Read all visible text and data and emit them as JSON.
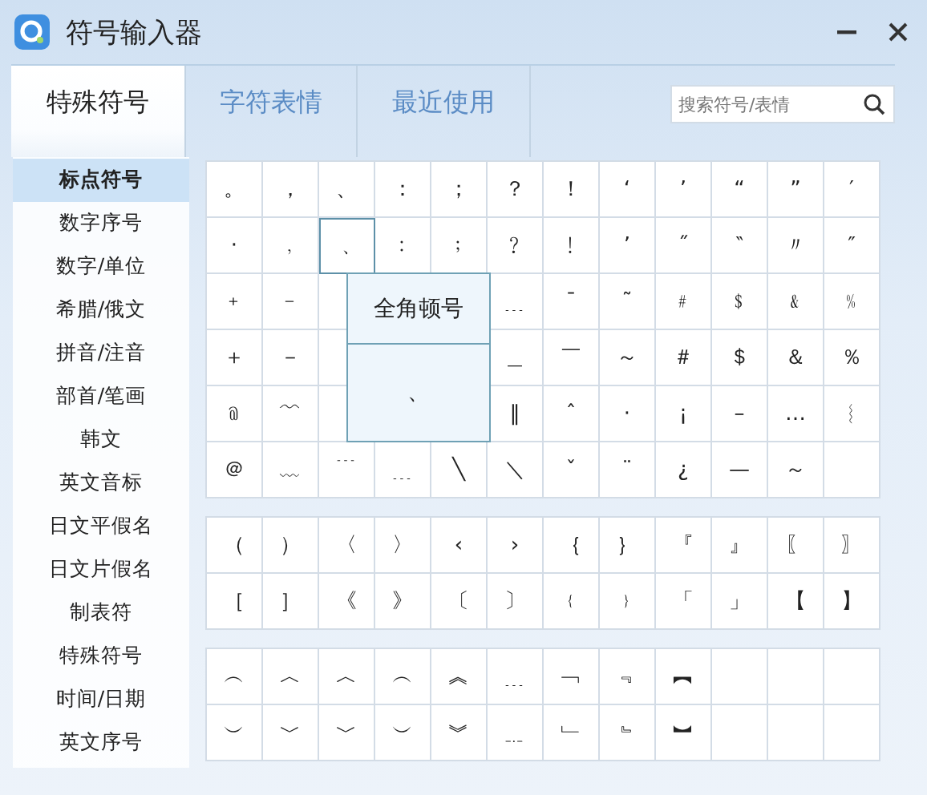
{
  "window": {
    "title": "符号输入器"
  },
  "tabs": [
    {
      "label": "特殊符号",
      "selected": true
    },
    {
      "label": "字符表情",
      "selected": false
    },
    {
      "label": "最近使用",
      "selected": false
    }
  ],
  "search": {
    "placeholder": "搜索符号/表情"
  },
  "sidebar": {
    "items": [
      {
        "label": "标点符号",
        "selected": true
      },
      {
        "label": "数字序号",
        "selected": false
      },
      {
        "label": "数字/单位",
        "selected": false
      },
      {
        "label": "希腊/俄文",
        "selected": false
      },
      {
        "label": "拼音/注音",
        "selected": false
      },
      {
        "label": "部首/笔画",
        "selected": false
      },
      {
        "label": "韩文",
        "selected": false
      },
      {
        "label": "英文音标",
        "selected": false
      },
      {
        "label": "日文平假名",
        "selected": false
      },
      {
        "label": "日文片假名",
        "selected": false
      },
      {
        "label": "制表符",
        "selected": false
      },
      {
        "label": "特殊符号",
        "selected": false
      },
      {
        "label": "时间/日期",
        "selected": false
      },
      {
        "label": "英文序号",
        "selected": false
      }
    ]
  },
  "blocks": [
    {
      "rows": [
        [
          {
            "symbol": "。",
            "hovered": false
          },
          {
            "symbol": "，",
            "hovered": false
          },
          {
            "symbol": "、",
            "hovered": false
          },
          {
            "symbol": "：",
            "hovered": false
          },
          {
            "symbol": "；",
            "hovered": false
          },
          {
            "symbol": "？",
            "hovered": false
          },
          {
            "symbol": "！",
            "hovered": false
          },
          {
            "symbol": "‘",
            "hovered": false
          },
          {
            "symbol": "’",
            "hovered": false
          },
          {
            "symbol": "“",
            "hovered": false
          },
          {
            "symbol": "”",
            "hovered": false
          },
          {
            "symbol": "′",
            "hovered": false
          }
        ],
        [
          {
            "symbol": "·",
            "hovered": false
          },
          {
            "symbol": "﹐",
            "hovered": false
          },
          {
            "symbol": "﹑",
            "hovered": true
          },
          {
            "symbol": "﹕",
            "hovered": false
          },
          {
            "symbol": "﹔",
            "hovered": false
          },
          {
            "symbol": "﹖",
            "hovered": false
          },
          {
            "symbol": "﹗",
            "hovered": false
          },
          {
            "symbol": "ʼ",
            "hovered": false
          },
          {
            "symbol": "˝",
            "hovered": false
          },
          {
            "symbol": "‶",
            "hovered": false
          },
          {
            "symbol": "〃",
            "hovered": false
          },
          {
            "symbol": "″",
            "hovered": false
          }
        ],
        [
          {
            "symbol": "﹢",
            "hovered": false
          },
          {
            "symbol": "﹣",
            "hovered": false
          },
          null,
          null,
          null,
          {
            "symbol": "﹍",
            "hovered": false
          },
          {
            "symbol": "¯",
            "hovered": false
          },
          {
            "symbol": "˜",
            "hovered": false
          },
          {
            "symbol": "﹟",
            "hovered": false
          },
          {
            "symbol": "﹩",
            "hovered": false
          },
          {
            "symbol": "﹠",
            "hovered": false
          },
          {
            "symbol": "﹪",
            "hovered": false
          }
        ],
        [
          {
            "symbol": "＋",
            "hovered": false
          },
          {
            "symbol": "－",
            "hovered": false
          },
          null,
          null,
          null,
          {
            "symbol": "＿",
            "hovered": false
          },
          {
            "symbol": "￣",
            "hovered": false
          },
          {
            "symbol": "～",
            "hovered": false
          },
          {
            "symbol": "＃",
            "hovered": false
          },
          {
            "symbol": "＄",
            "hovered": false
          },
          {
            "symbol": "＆",
            "hovered": false
          },
          {
            "symbol": "％",
            "hovered": false
          }
        ],
        [
          {
            "symbol": "﹫",
            "hovered": false
          },
          {
            "symbol": "﹌",
            "hovered": false
          },
          null,
          null,
          null,
          {
            "symbol": "‖",
            "hovered": false
          },
          {
            "symbol": "ˆ",
            "hovered": false
          },
          {
            "symbol": "·",
            "hovered": false
          },
          {
            "symbol": "¡",
            "hovered": false
          },
          {
            "symbol": "–",
            "hovered": false
          },
          {
            "symbol": "…",
            "hovered": false
          },
          {
            "symbol": "︴",
            "hovered": false
          }
        ],
        [
          {
            "symbol": "＠",
            "hovered": false
          },
          {
            "symbol": "﹏",
            "hovered": false
          },
          {
            "symbol": "﹉",
            "hovered": false
          },
          {
            "symbol": "﹍",
            "hovered": false
          },
          {
            "symbol": "╲",
            "hovered": false
          },
          {
            "symbol": "＼",
            "hovered": false
          },
          {
            "symbol": "ˇ",
            "hovered": false
          },
          {
            "symbol": "¨",
            "hovered": false
          },
          {
            "symbol": "¿",
            "hovered": false
          },
          {
            "symbol": "—",
            "hovered": false
          },
          {
            "symbol": "～",
            "hovered": false
          },
          null
        ]
      ]
    },
    {
      "rows": [
        [
          {
            "symbol": "（",
            "hovered": false
          },
          {
            "symbol": "）",
            "hovered": false
          },
          {
            "symbol": "〈",
            "hovered": false
          },
          {
            "symbol": "〉",
            "hovered": false
          },
          {
            "symbol": "‹",
            "hovered": false
          },
          {
            "symbol": "›",
            "hovered": false
          },
          {
            "symbol": "｛",
            "hovered": false
          },
          {
            "symbol": "｝",
            "hovered": false
          },
          {
            "symbol": "『",
            "hovered": false
          },
          {
            "symbol": "』",
            "hovered": false
          },
          {
            "symbol": "〖",
            "hovered": false
          },
          {
            "symbol": "〗",
            "hovered": false
          }
        ],
        [
          {
            "symbol": "［",
            "hovered": false
          },
          {
            "symbol": "］",
            "hovered": false
          },
          {
            "symbol": "《",
            "hovered": false
          },
          {
            "symbol": "》",
            "hovered": false
          },
          {
            "symbol": "〔",
            "hovered": false
          },
          {
            "symbol": "〕",
            "hovered": false
          },
          {
            "symbol": "﹛",
            "hovered": false
          },
          {
            "symbol": "﹜",
            "hovered": false
          },
          {
            "symbol": "「",
            "hovered": false
          },
          {
            "symbol": "」",
            "hovered": false
          },
          {
            "symbol": "【",
            "hovered": false
          },
          {
            "symbol": "】",
            "hovered": false
          }
        ]
      ]
    },
    {
      "rows": [
        [
          {
            "symbol": "︵",
            "hovered": false
          },
          {
            "symbol": "︿",
            "hovered": false
          },
          {
            "symbol": "︿",
            "hovered": false
          },
          {
            "symbol": "︵",
            "hovered": false
          },
          {
            "symbol": "︽",
            "hovered": false
          },
          {
            "symbol": "﹍",
            "hovered": false
          },
          {
            "symbol": "﹁",
            "hovered": false
          },
          {
            "symbol": "﹃",
            "hovered": false
          },
          {
            "symbol": "︻",
            "hovered": false
          },
          null,
          null,
          null
        ],
        [
          {
            "symbol": "︶",
            "hovered": false
          },
          {
            "symbol": "﹀",
            "hovered": false
          },
          {
            "symbol": "﹀",
            "hovered": false
          },
          {
            "symbol": "︶",
            "hovered": false
          },
          {
            "symbol": "︾",
            "hovered": false
          },
          {
            "symbol": "﹎",
            "hovered": false
          },
          {
            "symbol": "﹂",
            "hovered": false
          },
          {
            "symbol": "﹄",
            "hovered": false
          },
          {
            "symbol": "︼",
            "hovered": false
          },
          null,
          null,
          null
        ]
      ]
    }
  ],
  "tooltip": {
    "title": "全角顿号",
    "preview": "、"
  }
}
